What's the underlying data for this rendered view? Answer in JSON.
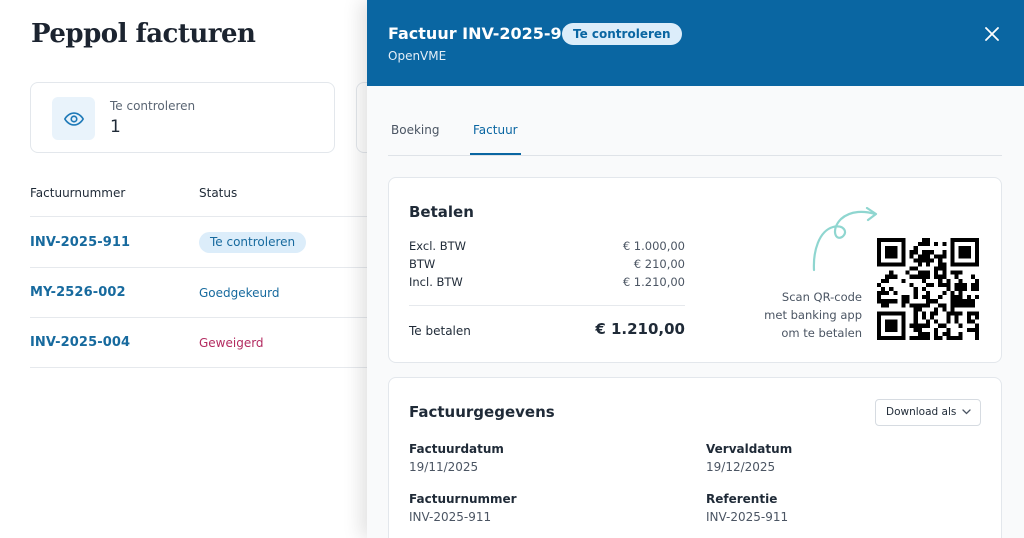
{
  "page": {
    "title": "Peppol facturen",
    "stat": {
      "label": "Te controleren",
      "value": "1"
    },
    "table": {
      "headers": [
        "Factuurnummer",
        "Status"
      ],
      "rows": [
        {
          "number": "INV-2025-911",
          "status": "Te controleren"
        },
        {
          "number": "MY-2526-002",
          "status": "Goedgekeurd"
        },
        {
          "number": "INV-2025-004",
          "status": "Geweigerd"
        }
      ]
    }
  },
  "drawer": {
    "title": "Factuur INV-2025-911",
    "status_badge": "Te controleren",
    "subtitle": "OpenVME",
    "tabs": [
      {
        "label": "Boeking",
        "active": false
      },
      {
        "label": "Factuur",
        "active": true
      }
    ],
    "payment": {
      "title": "Betalen",
      "lines": [
        {
          "label": "Excl. BTW",
          "value": "€ 1.000,00"
        },
        {
          "label": "BTW",
          "value": "€ 210,00"
        },
        {
          "label": "Incl. BTW",
          "value": "€ 1.210,00"
        }
      ],
      "total_label": "Te betalen",
      "total_value": "€ 1.210,00",
      "qr_text": [
        "Scan QR-code",
        "met banking app",
        "om te betalen"
      ]
    },
    "details": {
      "title": "Factuurgegevens",
      "download_label": "Download als",
      "fields": [
        {
          "label": "Factuurdatum",
          "value": "19/11/2025"
        },
        {
          "label": "Vervaldatum",
          "value": "19/12/2025"
        },
        {
          "label": "Factuurnummer",
          "value": "INV-2025-911"
        },
        {
          "label": "Referentie",
          "value": "INV-2025-911"
        }
      ]
    }
  },
  "colors": {
    "brand": "#0a66a2",
    "badge_bg": "#dcedfa",
    "approved": "#176a9e",
    "rejected": "#b32b60",
    "arrow": "#8fd6d0"
  },
  "icons": [
    "eye-icon",
    "close-icon",
    "arrow-doodle-icon",
    "chevron-down-icon",
    "qr-code"
  ]
}
